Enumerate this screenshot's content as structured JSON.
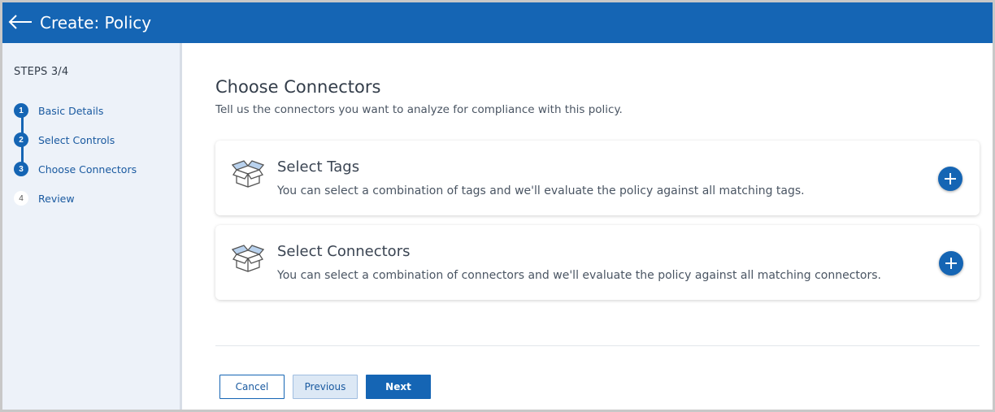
{
  "header": {
    "title": "Create: Policy"
  },
  "sidebar": {
    "steps_label": "STEPS 3/4",
    "steps": [
      {
        "number": "1",
        "label": "Basic Details",
        "status": "done"
      },
      {
        "number": "2",
        "label": "Select Controls",
        "status": "done"
      },
      {
        "number": "3",
        "label": "Choose Connectors",
        "status": "current"
      },
      {
        "number": "4",
        "label": "Review",
        "status": "todo"
      }
    ]
  },
  "main": {
    "title": "Choose Connectors",
    "subtitle": "Tell us the connectors you want to analyze for compliance with this policy.",
    "cards": [
      {
        "title": "Select Tags",
        "description": "You can select a combination of tags and we'll evaluate the policy against all matching tags.",
        "icon": "open-box-icon"
      },
      {
        "title": "Select Connectors",
        "description": "You can select a combination of connectors and we'll evaluate the policy against all matching connectors.",
        "icon": "open-box-icon"
      }
    ]
  },
  "footer": {
    "cancel_label": "Cancel",
    "previous_label": "Previous",
    "next_label": "Next"
  },
  "colors": {
    "primary": "#1565b4",
    "sidebar_bg": "#edf2f9",
    "text_dark": "#333d4a"
  }
}
